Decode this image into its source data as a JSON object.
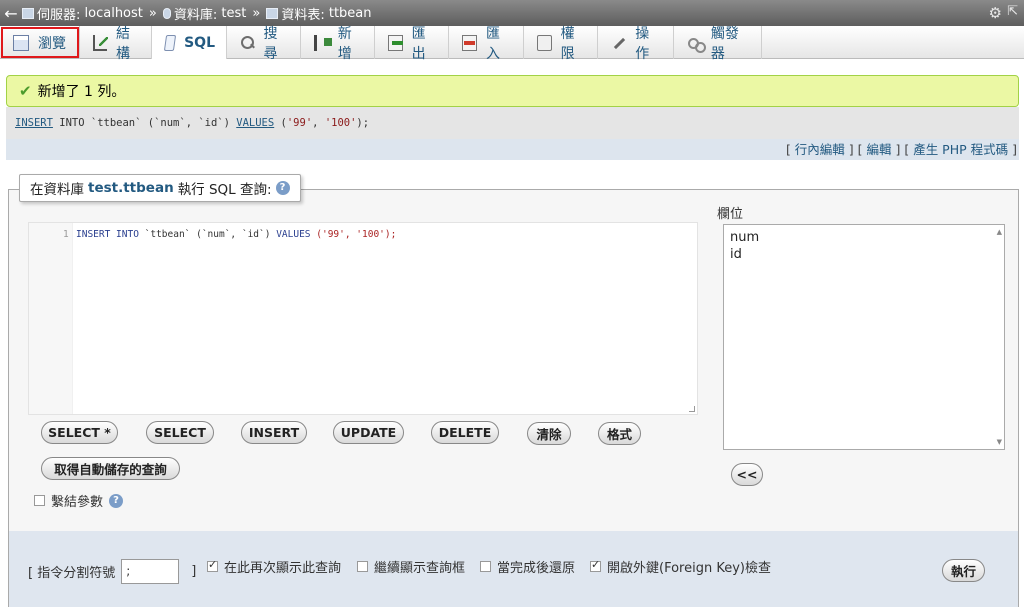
{
  "breadcrumb": {
    "server_label": "伺服器:",
    "server": "localhost",
    "database_label": "資料庫:",
    "database": "test",
    "table_label": "資料表:",
    "table": "ttbean",
    "separator": "»"
  },
  "tabs": [
    {
      "label": "瀏覽",
      "icon": "browse-icon"
    },
    {
      "label": "結構",
      "icon": "structure-icon"
    },
    {
      "label": "SQL",
      "icon": "sql-icon"
    },
    {
      "label": "搜尋",
      "icon": "search-icon"
    },
    {
      "label": "新增",
      "icon": "insert-icon"
    },
    {
      "label": "匯出",
      "icon": "export-icon"
    },
    {
      "label": "匯入",
      "icon": "import-icon"
    },
    {
      "label": "權限",
      "icon": "privileges-icon"
    },
    {
      "label": "操作",
      "icon": "operations-icon"
    },
    {
      "label": "觸發器",
      "icon": "triggers-icon"
    }
  ],
  "notice": {
    "message": "新增了 1 列。"
  },
  "executed_query": {
    "kw1": "INSERT",
    "into": " INTO `ttbean` (`num`, `id`) ",
    "kw2": "VALUES",
    "open": " (",
    "v1": "'99'",
    "comma": ", ",
    "v2": "'100'",
    "close": ");"
  },
  "links": {
    "bracket_open": "[ ",
    "inline_edit": "行內編輯",
    "sep": " ] [ ",
    "edit": "編輯",
    "create_php": "產生 PHP 程式碼",
    "bracket_close": " ]"
  },
  "query_box": {
    "legend_prefix": "在資料庫",
    "legend_table": "test.ttbean",
    "legend_suffix": "執行 SQL 查詢:",
    "help": "?",
    "line_number": "1",
    "code_k1": "INSERT INTO",
    "code_t": " `ttbean` (`num`, `id`) ",
    "code_k2": "VALUES",
    "code_s": " ('99', '100');"
  },
  "buttons": {
    "select_star": "SELECT *",
    "select": "SELECT",
    "insert": "INSERT",
    "update": "UPDATE",
    "delete": "DELETE",
    "clear": "清除",
    "format": "格式",
    "get_autosaved": "取得自動儲存的查詢",
    "bind_params": "繫結參數",
    "insert_field": "<<",
    "go": "執行"
  },
  "fields": {
    "label": "欄位",
    "items": [
      "num",
      "id"
    ]
  },
  "options": {
    "delimiter_label": "[ 指令分割符號",
    "delimiter_value": ";",
    "delimiter_close": "]",
    "show_query_again": "在此再次顯示此查詢",
    "retain_query_box": "繼續顯示查詢框",
    "rollback": "當完成後還原",
    "foreign_key_checks": "開啟外鍵(Foreign Key)檢查"
  }
}
